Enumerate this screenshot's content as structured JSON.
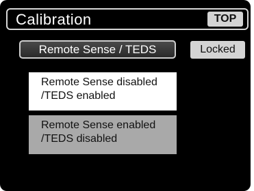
{
  "header": {
    "title": "Calibration",
    "top_button": "TOP"
  },
  "mode": {
    "remote_sense_label": "Remote Sense / TEDS",
    "lock_status": "Locked"
  },
  "options": [
    {
      "line1": "Remote Sense disabled",
      "line2": "/TEDS enabled",
      "selected": true
    },
    {
      "line1": "Remote Sense enabled",
      "line2": "/TEDS disabled",
      "selected": false
    }
  ],
  "colors": {
    "screen_background": "#000000",
    "selected_option": "#ffffff",
    "unselected_option": "#a9a9a9",
    "button_gray": "#d4d4d4"
  }
}
